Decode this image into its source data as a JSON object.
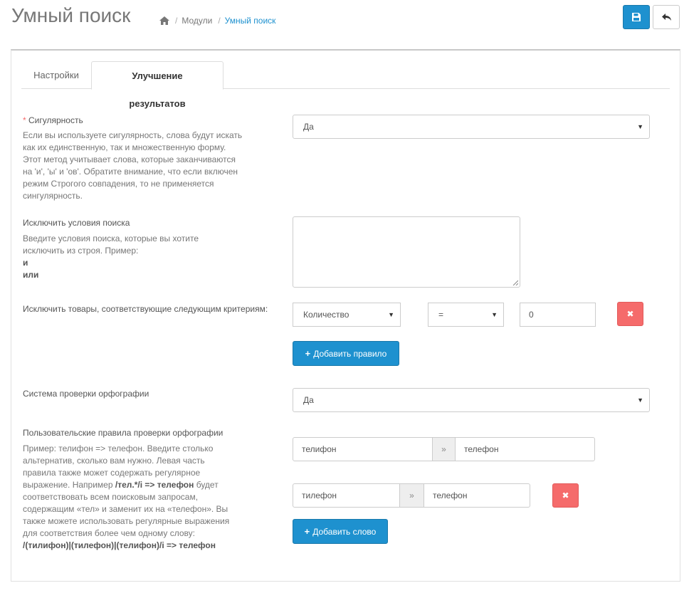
{
  "header": {
    "title": "Умный поиск",
    "breadcrumb": [
      "Модули",
      "Умный поиск"
    ]
  },
  "tabs": [
    {
      "label": "Настройки",
      "active": false
    },
    {
      "label": "Улучшение результатов",
      "active": true
    }
  ],
  "singularity": {
    "required_mark": "*",
    "label": "Сигулярность",
    "help": "Если вы используете сигулярность, слова будут искать как их единственную, так и множественную форму. Этот метод учитывает слова, которые заканчиваются на 'и', 'ы' и 'ов'. Обратите внимание, что если включен режим Строгого совпадения, то не применяется сингулярность.",
    "value": "Да"
  },
  "exclude_terms": {
    "label": "Исключить условия поиска",
    "help": "Введите условия поиска, которые вы хотите исключить из строя. Пример:",
    "example_1": "и",
    "example_2": "или",
    "value": ""
  },
  "exclude_products": {
    "label": "Исключить товары, соответствующие следующим критериям:",
    "field": "Количество",
    "operator": "=",
    "value": "0",
    "add_label": "Добавить правило"
  },
  "spellcheck": {
    "label": "Система проверки орфографии",
    "value": "Да"
  },
  "spell_rules": {
    "label": "Пользовательские правила проверки орфографии",
    "help_1": "Пример: телифон => телефон. Введите столько альтернатив, сколько вам нужно. Левая часть правила также может содержать регулярное выражение. Например",
    "help_bold_1": "/тел.*/i => телефон",
    "help_2": "будет соответствовать всем поисковым запросам, содержащим «тел» и заменит их на «телефон». Вы также можете использовать регулярные выражения для соответствия более чем одному слову:",
    "help_bold_2": "/(тилифон)|(тилефон)|(телифон)/i => телефон",
    "rows": [
      {
        "from": "телифон",
        "arrow": "»",
        "to": "телефон"
      },
      {
        "from": "тилефон",
        "arrow": "»",
        "to": "телефон"
      }
    ],
    "add_label": "Добавить слово"
  },
  "colors": {
    "primary": "#1e91cf",
    "danger": "#f56b6b",
    "required": "#f56b6b"
  }
}
